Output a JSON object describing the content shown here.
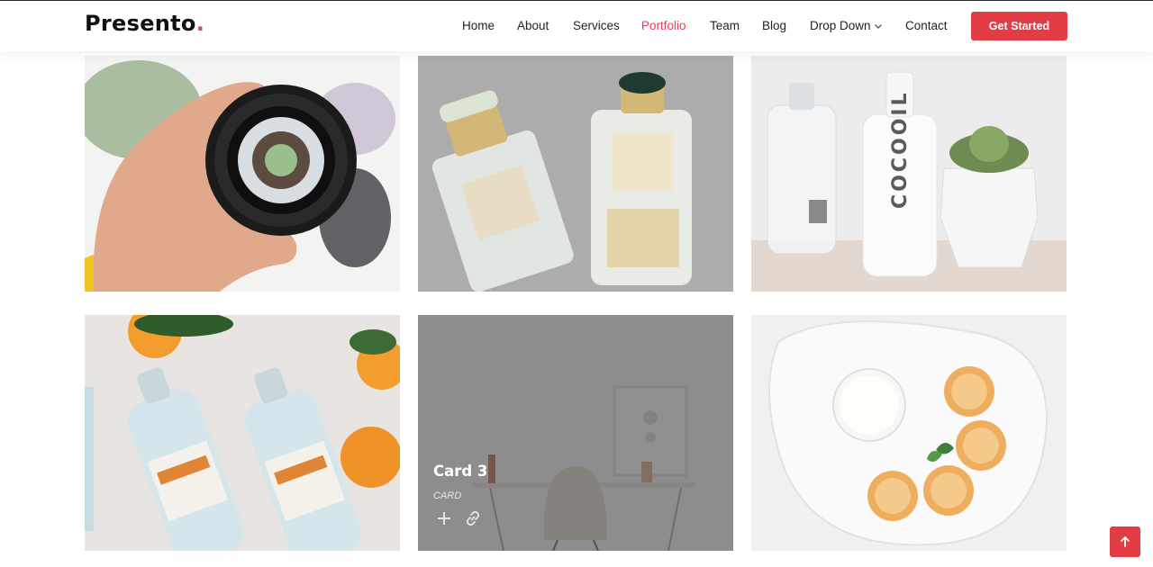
{
  "header": {
    "logo_text": "Presento",
    "logo_dot": ".",
    "nav": [
      {
        "label": "Home"
      },
      {
        "label": "About"
      },
      {
        "label": "Services"
      },
      {
        "label": "Portfolio",
        "active": true
      },
      {
        "label": "Team"
      },
      {
        "label": "Blog"
      },
      {
        "label": "Drop Down",
        "has_dropdown": true,
        "icon": "chevron-down-icon"
      },
      {
        "label": "Contact"
      }
    ],
    "cta_label": "Get Started"
  },
  "portfolio": {
    "items": [
      {
        "subject": "hand holding camera lens"
      },
      {
        "subject": "AERIN perfume bottles"
      },
      {
        "subject": "COCOOIL bottle and plant"
      },
      {
        "subject": "Acqua Panna bottles with oranges"
      },
      {
        "subject": "white chair and desk",
        "hover": true,
        "title": "Card 3",
        "category": "CARD",
        "actions": [
          "plus-icon",
          "link-icon"
        ]
      },
      {
        "subject": "plate with pastries and cream"
      }
    ]
  },
  "colors": {
    "accent": "#e23d45",
    "text": "#222222",
    "overlay": "rgba(80,80,80,0.62)"
  },
  "back_to_top": {
    "icon": "arrow-up-icon"
  }
}
